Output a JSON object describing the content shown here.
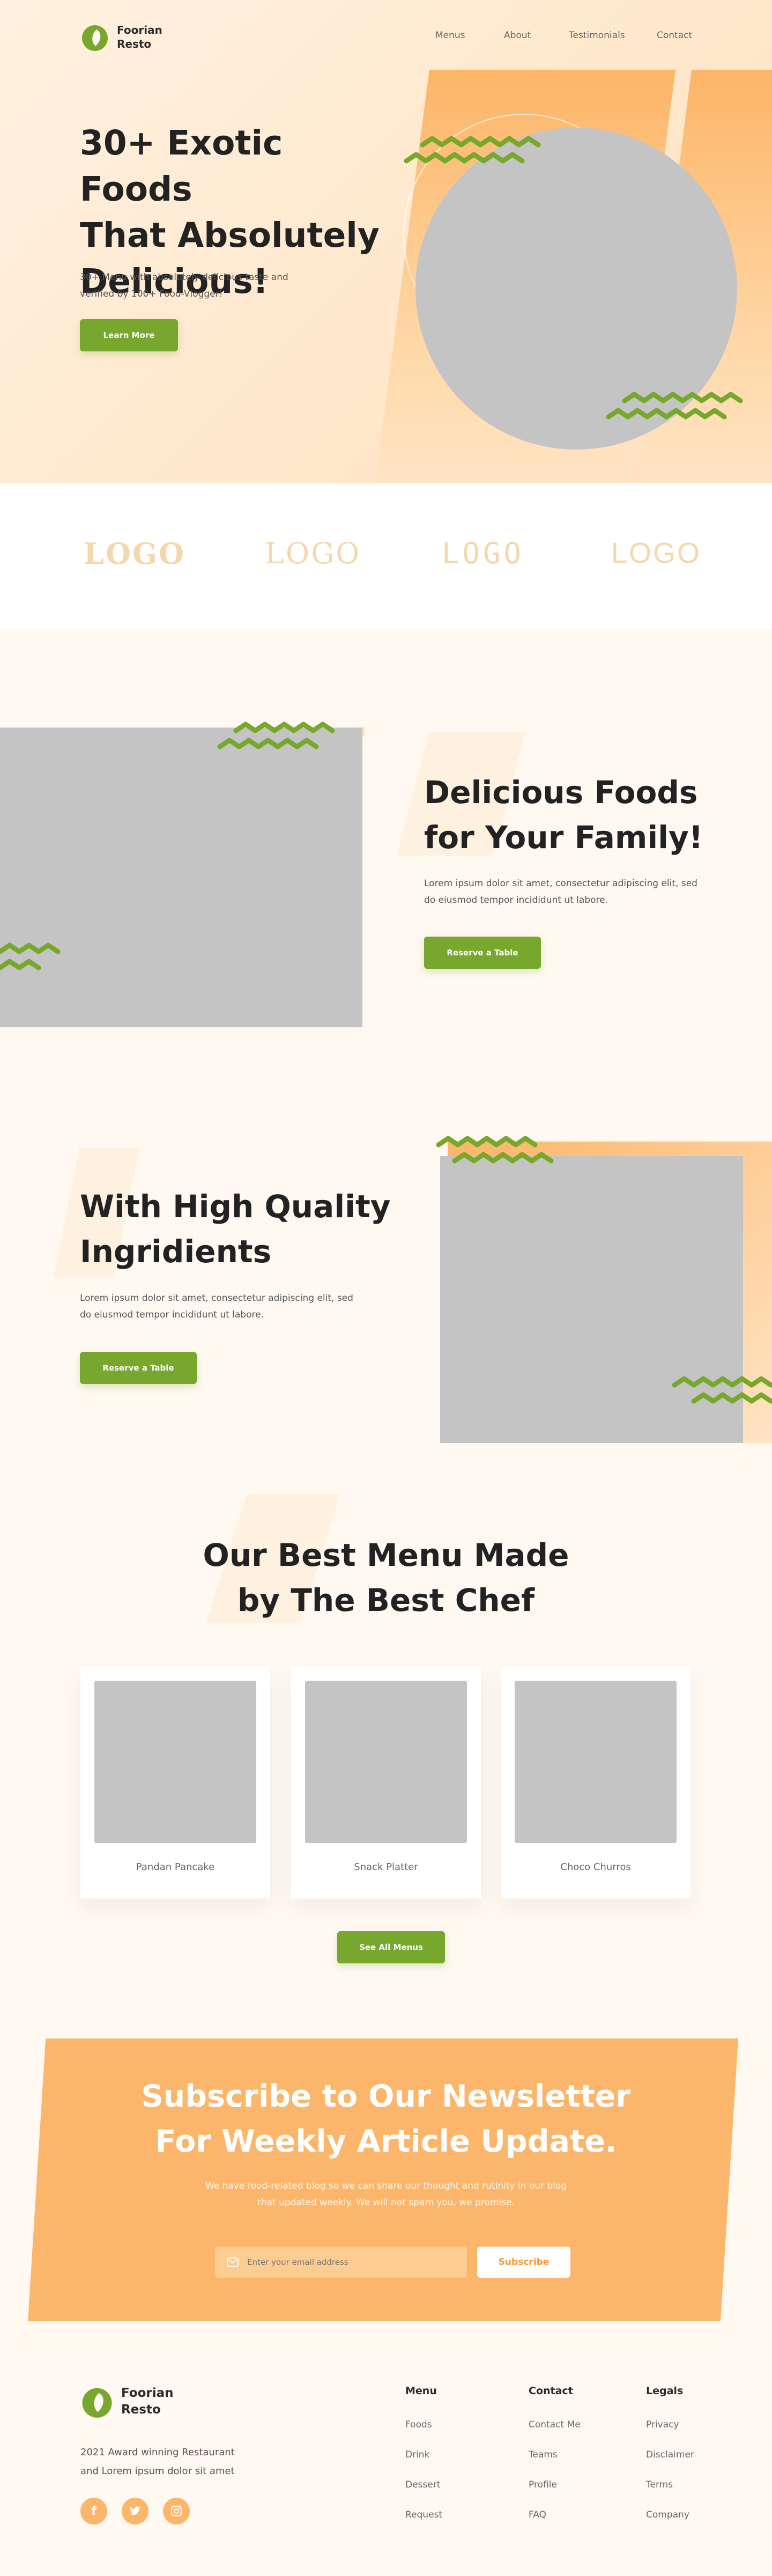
{
  "brand": {
    "line1": "Foorian",
    "line2": "Resto"
  },
  "nav": [
    "Menus",
    "About",
    "Testimonials",
    "Contact"
  ],
  "hero": {
    "title": [
      "30+ Exotic Foods",
      "That Absolutely",
      "Delicious!"
    ],
    "text": [
      "30+ Menu with absolutely delicious taste and",
      "verified by 100+ Food-Vlogger!"
    ],
    "button": "Learn More"
  },
  "logos": [
    "LOGO",
    "LOGO",
    "LOGO",
    "LOGO"
  ],
  "family": {
    "title": [
      "Delicious Foods",
      "for Your Family!"
    ],
    "text": [
      "Lorem ipsum dolor sit amet, consectetur adipiscing elit, sed",
      "do eiusmod tempor incididunt ut labore."
    ],
    "button": "Reserve a Table"
  },
  "quality": {
    "title": [
      "With High Quality",
      "Ingridients"
    ],
    "text": [
      "Lorem ipsum dolor sit amet, consectetur adipiscing elit, sed",
      "do eiusmod tempor incididunt ut labore."
    ],
    "button": "Reserve a Table"
  },
  "menu": {
    "title": [
      "Our Best Menu Made",
      "by The Best Chef"
    ],
    "items": [
      "Pandan Pancake",
      "Snack Platter",
      "Choco Churros"
    ],
    "button": "See All Menus"
  },
  "newsletter": {
    "title": [
      "Subscribe to Our Newsletter",
      "For Weekly Article Update."
    ],
    "text": [
      "We have food-related blog so we can share our thought and rutinity in our blog",
      "that updated weekly. We will not spam you, we promise."
    ],
    "placeholder": "Enter your email address",
    "button": "Subscribe"
  },
  "footer": {
    "about": [
      "2021 Award winning Restaurant",
      "and Lorem ipsum dolor sit amet"
    ],
    "social": [
      "facebook-icon",
      "twitter-icon",
      "instagram-icon"
    ],
    "columns": [
      {
        "title": "Menu",
        "links": [
          "Foods",
          "Drink",
          "Dessert",
          "Request"
        ]
      },
      {
        "title": "Contact",
        "links": [
          "Contact Me",
          "Teams",
          "Profile",
          "FAQ"
        ]
      },
      {
        "title": "Legals",
        "links": [
          "Privacy",
          "Disclaimer",
          "Terms",
          "Company"
        ]
      }
    ]
  },
  "colors": {
    "accent": "#78a72d",
    "orange": "#fcb66b",
    "cream": "#fff9f1"
  }
}
